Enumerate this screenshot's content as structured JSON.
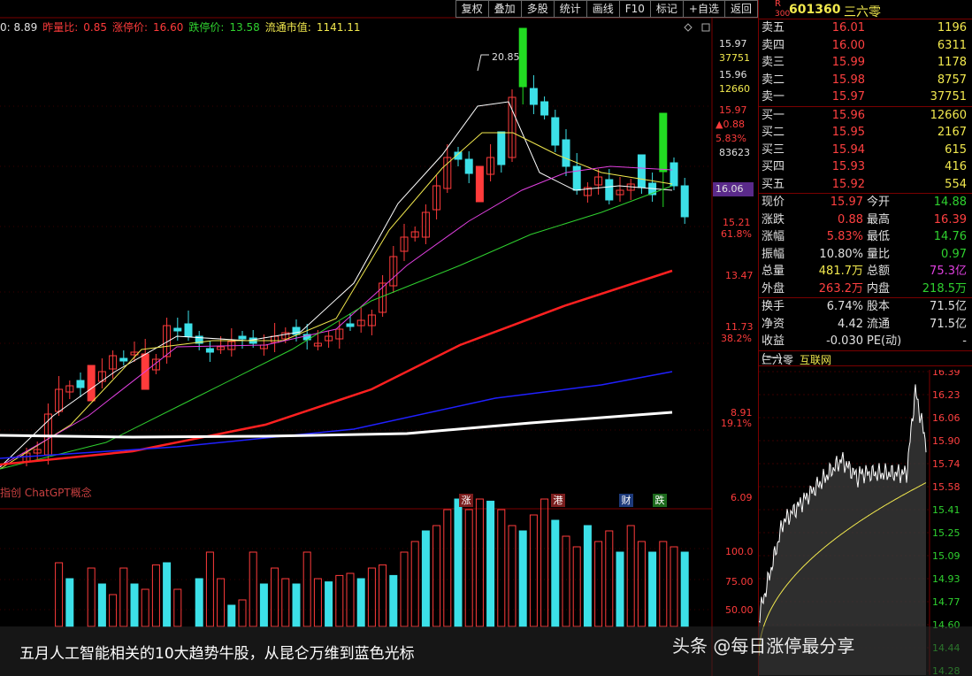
{
  "toolbar": [
    "复权",
    "叠加",
    "多股",
    "统计",
    "画线",
    "F10",
    "标记",
    "+自选",
    "返回"
  ],
  "stats": {
    "prefix": "0: 8.89",
    "lb_label": "昨量比:",
    "lb_value": "0.85",
    "zt_label": "涨停价:",
    "zt_value": "16.60",
    "dt_label": "跌停价:",
    "dt_value": "13.58",
    "cap_label": "流通市值:",
    "cap_value": "1141.11"
  },
  "concept": "指创 ChatGPT概念",
  "peak_label": "20.85",
  "events": [
    "涨",
    "港",
    "财",
    "跌"
  ],
  "price_axis": {
    "top_price": "15.97",
    "top_vol": "37751",
    "bid_price": "15.96",
    "bid_vol": "12660",
    "last": "15.97",
    "chg": "▲0.88",
    "pct": "5.83%",
    "vol": "83623",
    "current": "16.06",
    "l1": "15.21",
    "l1pct": "61.8%",
    "l2": "13.47",
    "l3": "11.73",
    "l3pct": "38.2%",
    "l4": "8.91",
    "l4pct": "19.1%",
    "l5": "6.09"
  },
  "volume_axis": [
    "100.0",
    "75.00",
    "50.00"
  ],
  "header": {
    "r_tag": "R",
    "r_sub": "300",
    "code": "601360",
    "name": "三六零"
  },
  "asks": [
    {
      "label": "卖五",
      "price": "16.01",
      "vol": "1196"
    },
    {
      "label": "卖四",
      "price": "16.00",
      "vol": "6311"
    },
    {
      "label": "卖三",
      "price": "15.99",
      "vol": "1178"
    },
    {
      "label": "卖二",
      "price": "15.98",
      "vol": "8757"
    },
    {
      "label": "卖一",
      "price": "15.97",
      "vol": "37751"
    }
  ],
  "bids": [
    {
      "label": "买一",
      "price": "15.96",
      "vol": "12660"
    },
    {
      "label": "买二",
      "price": "15.95",
      "vol": "2167"
    },
    {
      "label": "买三",
      "price": "15.94",
      "vol": "615"
    },
    {
      "label": "买四",
      "price": "15.93",
      "vol": "416"
    },
    {
      "label": "买五",
      "price": "15.92",
      "vol": "554"
    }
  ],
  "quote1": [
    {
      "l1": "现价",
      "v1": "15.97",
      "c1": "#ff4040",
      "l2": "今开",
      "v2": "14.88",
      "c2": "#2fd12f"
    },
    {
      "l1": "涨跌",
      "v1": "0.88",
      "c1": "#ff4040",
      "l2": "最高",
      "v2": "16.39",
      "c2": "#ff4040"
    },
    {
      "l1": "涨幅",
      "v1": "5.83%",
      "c1": "#ff4040",
      "l2": "最低",
      "v2": "14.76",
      "c2": "#2fd12f"
    },
    {
      "l1": "振幅",
      "v1": "10.80%",
      "c1": "#e0e0e0",
      "l2": "量比",
      "v2": "0.97",
      "c2": "#2fd12f"
    },
    {
      "l1": "总量",
      "v1": "481.7万",
      "c1": "#f2e94e",
      "l2": "总额",
      "v2": "75.3亿",
      "c2": "#e040e0"
    },
    {
      "l1": "外盘",
      "v1": "263.2万",
      "c1": "#ff4040",
      "l2": "内盘",
      "v2": "218.5万",
      "c2": "#2fd12f"
    }
  ],
  "quote2": [
    {
      "l1": "换手",
      "v1": "6.74%",
      "c1": "#e0e0e0",
      "l2": "股本",
      "v2": "71.5亿",
      "c2": "#e0e0e0"
    },
    {
      "l1": "净资",
      "v1": "4.42",
      "c1": "#e0e0e0",
      "l2": "流通",
      "v2": "71.5亿",
      "c2": "#e0e0e0"
    },
    {
      "l1": "收益(一)",
      "v1": "-0.030",
      "c1": "#e0e0e0",
      "l2": "PE(动)",
      "v2": "-",
      "c2": "#e0e0e0"
    }
  ],
  "mini_tabs": [
    "三六零",
    "互联网"
  ],
  "mini_axis": [
    "16.39",
    "16.23",
    "16.06",
    "15.90",
    "15.74",
    "15.58",
    "15.41",
    "15.25",
    "15.09",
    "14.93",
    "14.77",
    "14.60",
    "14.44",
    "14.28"
  ],
  "caption": "五月人工智能相关的10大趋势牛股，从昆仑万维到蓝色光标",
  "watermark": "头条 @每日涨停最分享",
  "colors": {
    "up": "#ff3b3b",
    "down": "#3ce0e8",
    "limit_down": "#22dd22",
    "ma5": "#ffffff",
    "ma10": "#f2e94e",
    "ma20": "#e040e0",
    "ma30": "#2fd12f",
    "ma60": "#ff2020",
    "ma120": "#2020ff",
    "ma250": "#ffffff"
  }
}
